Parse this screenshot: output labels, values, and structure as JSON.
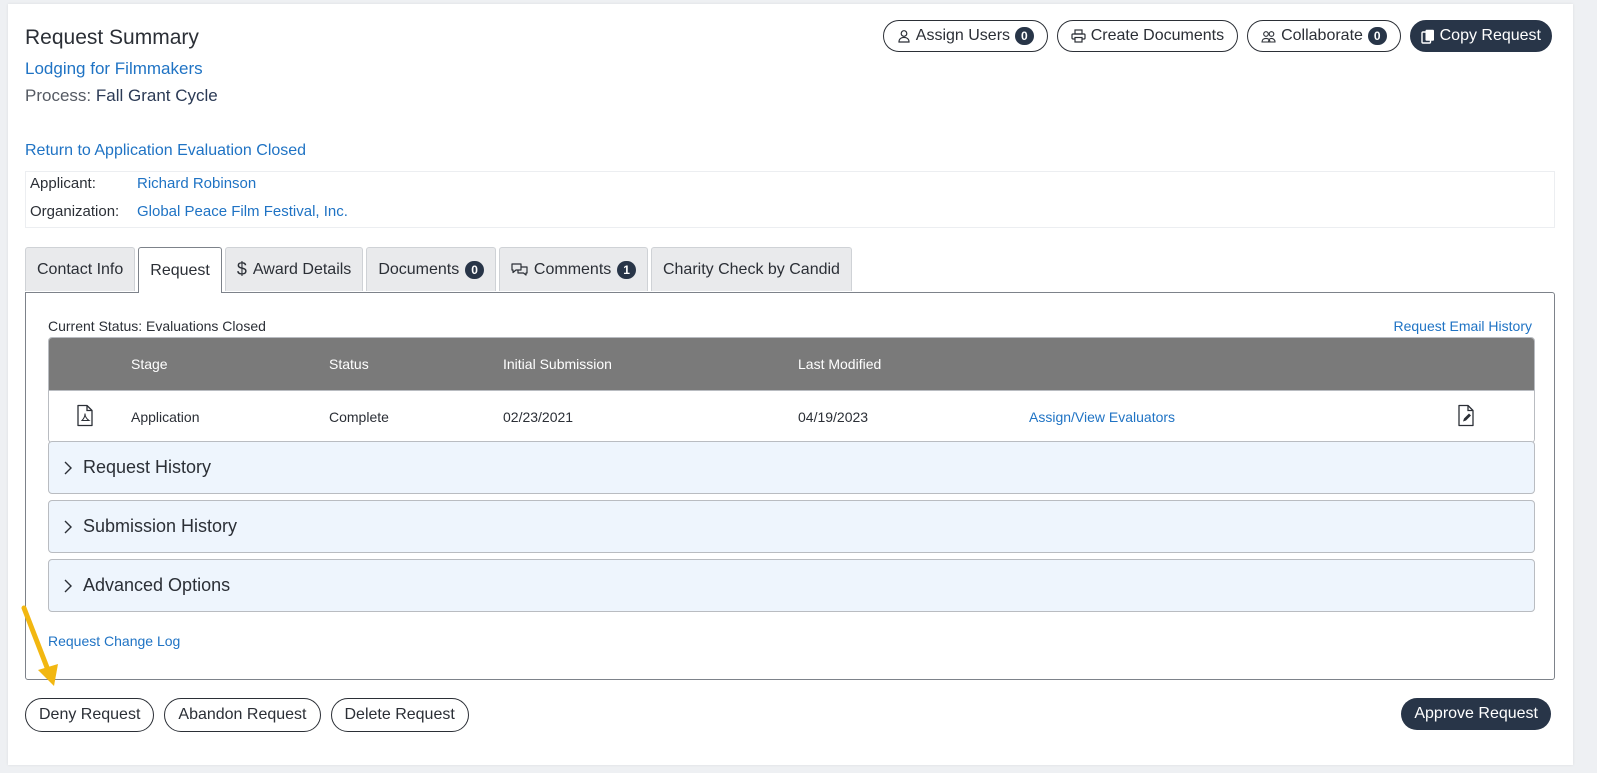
{
  "header": {
    "title": "Request Summary",
    "request_name": "Lodging for Filmmakers",
    "process_label": "Process:",
    "process_value": "Fall Grant Cycle",
    "return_link": "Return to Application Evaluation Closed"
  },
  "top_actions": {
    "assign_users": "Assign Users",
    "assign_users_count": "0",
    "create_documents": "Create Documents",
    "collaborate": "Collaborate",
    "collaborate_count": "0",
    "copy_request": "Copy Request"
  },
  "info": {
    "applicant_label": "Applicant:",
    "applicant_value": "Richard Robinson",
    "organization_label": "Organization:",
    "organization_value": "Global Peace Film Festival, Inc."
  },
  "tabs": {
    "contact_info": "Contact Info",
    "request": "Request",
    "award_details": "Award Details",
    "documents": "Documents",
    "documents_count": "0",
    "comments": "Comments",
    "comments_count": "1",
    "charity_check": "Charity Check by Candid"
  },
  "request_tab": {
    "current_status": "Current Status: Evaluations Closed",
    "email_history": "Request Email History",
    "table": {
      "headers": [
        "Stage",
        "Status",
        "Initial Submission",
        "Last Modified"
      ],
      "row": {
        "stage": "Application",
        "status": "Complete",
        "initial_submission": "02/23/2021",
        "last_modified": "04/19/2023",
        "action": "Assign/View Evaluators"
      }
    },
    "accordions": [
      "Request History",
      "Submission History",
      "Advanced Options"
    ],
    "change_log": "Request Change Log"
  },
  "bottom_actions": {
    "deny": "Deny Request",
    "abandon": "Abandon Request",
    "delete": "Delete Request",
    "approve": "Approve Request"
  },
  "colors": {
    "link": "#1f73c4",
    "dark_button": "#283548",
    "table_header": "#7a7a7a",
    "accordion_bg": "#eef5fd",
    "arrow": "#f2b711"
  }
}
